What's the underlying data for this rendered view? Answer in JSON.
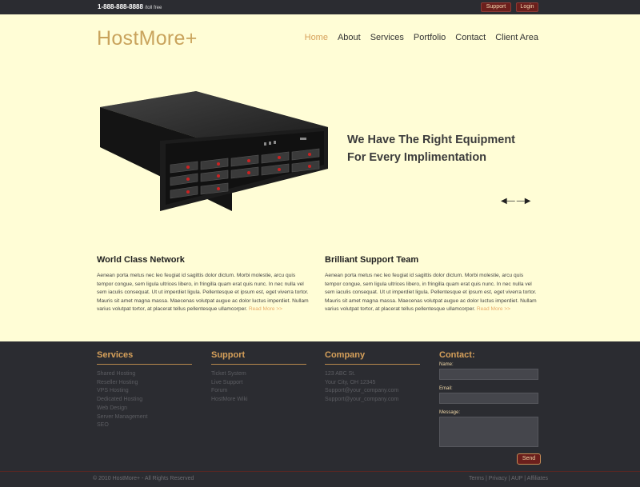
{
  "topbar": {
    "phone": "1-888-888-8888",
    "phone_note": "/toll free",
    "support": "Support",
    "login": "Login"
  },
  "brand": {
    "logo": "HostMore+"
  },
  "nav": [
    "Home",
    "About",
    "Services",
    "Portfolio",
    "Contact",
    "Client Area"
  ],
  "hero": {
    "line1": "We Have The Right Equipment",
    "line2": "For Every Implimentation",
    "prev_icon": "arrow-left-icon",
    "next_icon": "arrow-right-icon"
  },
  "features": [
    {
      "title": "World Class Network",
      "text": "Aenean porta metus nec leo feugiat id sagittis dolor dictum. Morbi molestie, arcu quis tempor congue, sem ligula ultrices libero, in fringilla quam erat quis nunc. In nec nulla vel sem iaculis consequat. Ut ut imperdiet ligula. Pellentesque et ipsum est, eget viverra tortor. Mauris sit amet magna massa. Maecenas volutpat augue ac dolor luctus imperdiet. Nullam varius volutpat tortor, at placerat tellus pellentesque ullamcorper.",
      "more": "Read More >>"
    },
    {
      "title": "Brilliant Support Team",
      "text": "Aenean porta metus nec leo feugiat id sagittis dolor dictum. Morbi molestie, arcu quis tempor congue, sem ligula ultrices libero, in fringilla quam erat quis nunc. In nec nulla vel sem iaculis consequat. Ut ut imperdiet ligula. Pellentesque et ipsum est, eget viverra tortor. Mauris sit amet magna massa. Maecenas volutpat augue ac dolor luctus imperdiet. Nullam varius volutpat tortor, at placerat tellus pellentesque ullamcorper.",
      "more": "Read More >>"
    }
  ],
  "footer": {
    "services": {
      "title": "Services",
      "items": [
        "Shared Hosting",
        "Reseller Hosting",
        "VPS Hosting",
        "Dedicated Hosting",
        "Web Design",
        "Server Management",
        "SEO"
      ]
    },
    "support": {
      "title": "Support",
      "items": [
        "Ticket System",
        "Live Support",
        "Forum",
        "HostMore Wiki"
      ]
    },
    "company": {
      "title": "Company",
      "items": [
        "123 ABC St.",
        "Your City, OH 12345",
        "Support@your_company.com",
        "Support@your_company.com"
      ]
    },
    "contact": {
      "title": "Contact:",
      "name_label": "Name:",
      "email_label": "Email:",
      "message_label": "Message:",
      "send": "Send"
    }
  },
  "bottom": {
    "copyright": "© 2010 HostMore+ - All Rights Reserved",
    "links": [
      "Terms",
      "Privacy",
      "AUP",
      "Affiliates"
    ]
  },
  "colors": {
    "accent": "#d6a05a",
    "background": "#fffdd6",
    "dark": "#2b2c31",
    "button": "#6b1f1c"
  }
}
